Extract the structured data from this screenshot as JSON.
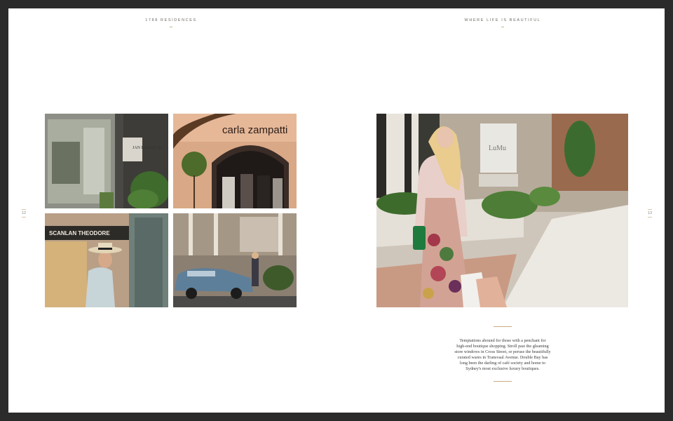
{
  "left_page": {
    "running_head": "1788 RESIDENCES",
    "folio": "12",
    "images": [
      {
        "name": "boutique-storefront-photo",
        "signage": "JAN LOGAN 36"
      },
      {
        "name": "carla-zampatti-storefront-photo",
        "signage": "carla zampatti"
      },
      {
        "name": "woman-in-hat-shopping-photo",
        "signage": "SCANLAN THEODORE"
      },
      {
        "name": "street-cafe-vintage-car-photo",
        "signage": ""
      }
    ]
  },
  "right_page": {
    "running_head": "WHERE LIFE IS BEAUTIFUL",
    "folio": "13",
    "hero_image": {
      "name": "woman-shopping-street-photo",
      "signage": "LuMu"
    },
    "body_text": [
      "Temptations abound for those with a penchant for",
      "high-end boutique shopping. Stroll past the gleaming",
      "store windows in Cross Street, or peruse the beautifully",
      "curated wares in Transvaal Avenue. Double Bay has",
      "long been the darling of café society and home to",
      "Sydney's most exclusive luxury boutiques."
    ]
  },
  "colors": {
    "frame": "#2b2b2b",
    "page": "#ffffff",
    "accent_rule": "#c9ab83"
  }
}
